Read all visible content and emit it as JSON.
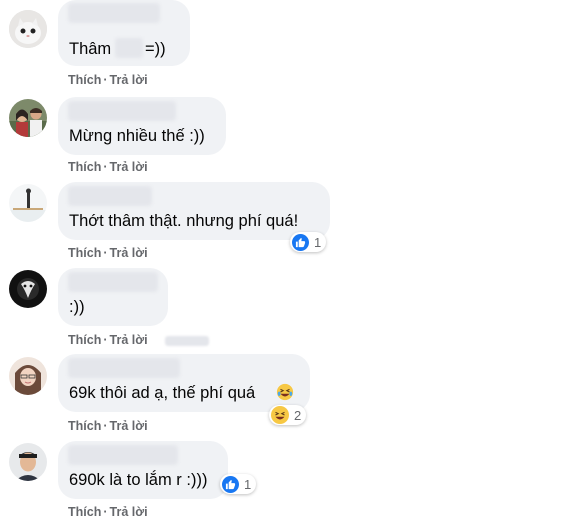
{
  "actions": {
    "like": "Thích",
    "reply": "Trả lời",
    "separator": "·"
  },
  "comments": [
    {
      "text": "Thâm",
      "text2": "=))"
    },
    {
      "text": "Mừng nhiều thế :))"
    },
    {
      "text": "Thớt thâm thật. nhưng phí quá!",
      "reaction": {
        "icon": "like-icon",
        "count": "1"
      }
    },
    {
      "text": ":))"
    },
    {
      "text": "69k thôi ad ạ, thế phí quá",
      "inline_emoji": "laughing-emoji",
      "reaction": {
        "icon": "haha-icon",
        "count": "2"
      }
    },
    {
      "text": "690k là to lắm r :)))",
      "reaction": {
        "icon": "like-icon",
        "count": "1"
      }
    }
  ],
  "colors": {
    "bubble": "#f0f2f5",
    "action_text": "#65676b",
    "like_blue": "#1877f2",
    "haha_yellow": "#f7c844"
  }
}
